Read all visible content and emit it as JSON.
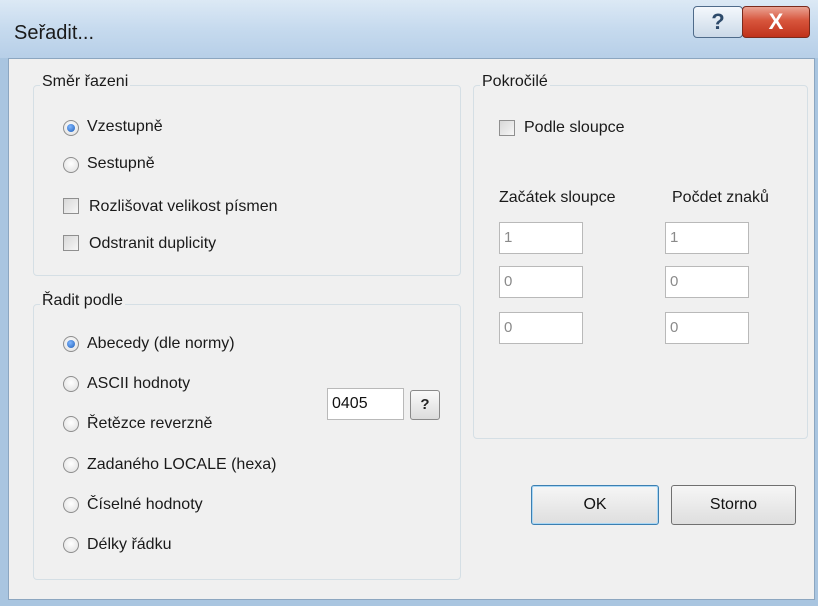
{
  "window": {
    "title": "Seřadit...",
    "help_glyph": "?",
    "close_glyph": "X"
  },
  "direction": {
    "title": "Směr řazeni",
    "ascending": "Vzestupně",
    "descending": "Sestupně",
    "case_sensitive": "Rozlišovat velikost písmen",
    "remove_duplicates": "Odstranit duplicity"
  },
  "sort_by": {
    "title": "Řadit podle",
    "options": [
      "Abecedy (dle normy)",
      "ASCII hodnoty",
      "Řetězce reverzně",
      "Zadaného LOCALE (hexa)",
      "Číselné hodnoty",
      "Délky řádku"
    ],
    "locale_value": "0405",
    "locale_help": "?"
  },
  "advanced": {
    "title": "Pokročilé",
    "by_column": "Podle sloupce",
    "col_start_label": "Začátek sloupce",
    "char_count_label": "Počdet znaků",
    "start_values": [
      "1",
      "0",
      "0"
    ],
    "count_values": [
      "1",
      "0",
      "0"
    ]
  },
  "buttons": {
    "ok": "OK",
    "cancel": "Storno"
  }
}
